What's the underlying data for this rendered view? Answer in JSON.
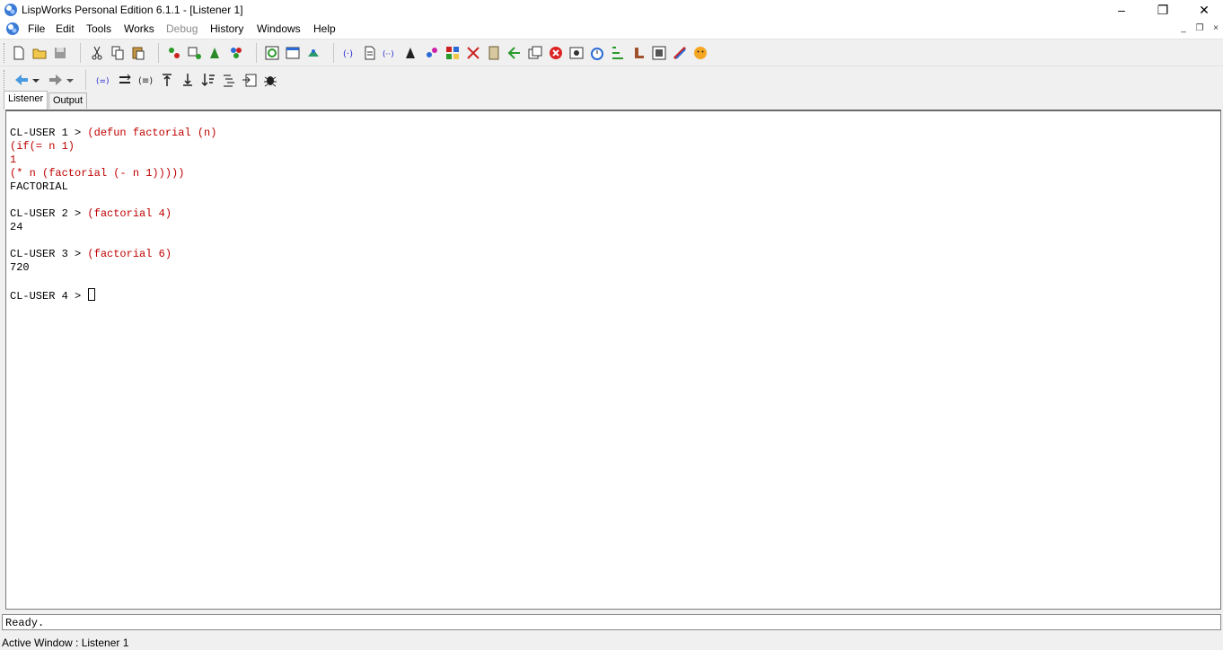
{
  "window": {
    "title": "LispWorks Personal Edition 6.1.1 - [Listener 1]",
    "controls": {
      "minimize": "–",
      "restore": "❐",
      "close": "✕"
    }
  },
  "menu": {
    "items": [
      {
        "label": "File",
        "enabled": true
      },
      {
        "label": "Edit",
        "enabled": true
      },
      {
        "label": "Tools",
        "enabled": true
      },
      {
        "label": "Works",
        "enabled": true
      },
      {
        "label": "Debug",
        "enabled": false
      },
      {
        "label": "History",
        "enabled": true
      },
      {
        "label": "Windows",
        "enabled": true
      },
      {
        "label": "Help",
        "enabled": true
      }
    ],
    "mdi_controls": {
      "minimize": "_",
      "restore": "❐",
      "close": "×"
    }
  },
  "tabs": [
    {
      "label": "Listener",
      "active": true
    },
    {
      "label": "Output",
      "active": false
    }
  ],
  "listener": {
    "lines": [
      {
        "prompt": "CL-USER 1 > ",
        "input": "(defun factorial (n)",
        "output": ""
      },
      {
        "prompt": "",
        "input": "(if(= n 1)",
        "output": ""
      },
      {
        "prompt": "",
        "input": "1",
        "output": ""
      },
      {
        "prompt": "",
        "input": "(* n (factorial (- n 1)))))",
        "output": ""
      },
      {
        "prompt": "",
        "input": "",
        "output": "FACTORIAL"
      },
      {
        "prompt": "",
        "input": "",
        "output": ""
      },
      {
        "prompt": "CL-USER 2 > ",
        "input": "(factorial 4)",
        "output": ""
      },
      {
        "prompt": "",
        "input": "",
        "output": "24"
      },
      {
        "prompt": "",
        "input": "",
        "output": ""
      },
      {
        "prompt": "CL-USER 3 > ",
        "input": "(factorial 6)",
        "output": ""
      },
      {
        "prompt": "",
        "input": "",
        "output": "720"
      },
      {
        "prompt": "",
        "input": "",
        "output": ""
      },
      {
        "prompt": "CL-USER 4 > ",
        "input": "",
        "output": ""
      }
    ]
  },
  "echo_area": "Ready.",
  "status_bar": "Active Window : Listener 1",
  "colors": {
    "input_text": "#c00000",
    "background": "#f0f0f0"
  }
}
